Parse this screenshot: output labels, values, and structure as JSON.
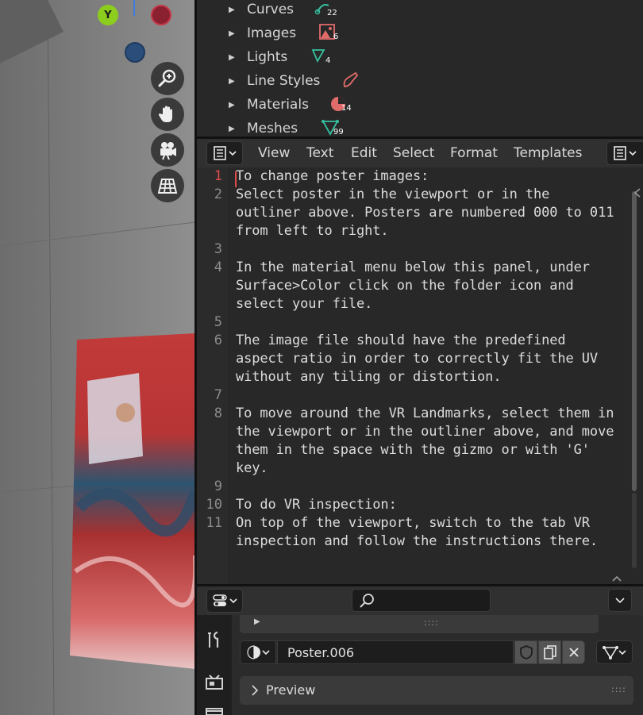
{
  "viewport": {
    "gizmo_y_label": "Y",
    "nav_buttons": [
      "zoom-icon",
      "hand-pan-icon",
      "camera-icon",
      "grid-perspective-icon"
    ]
  },
  "outliner": {
    "items": [
      {
        "label": "Curves",
        "count": "22",
        "icon": "curve-icon"
      },
      {
        "label": "Images",
        "count": "6",
        "icon": "image-icon"
      },
      {
        "label": "Lights",
        "count": "4",
        "icon": "light-icon"
      },
      {
        "label": "Line Styles",
        "count": "",
        "icon": "brush-icon"
      },
      {
        "label": "Materials",
        "count": "14",
        "icon": "material-icon"
      },
      {
        "label": "Meshes",
        "count": "99",
        "icon": "mesh-icon"
      }
    ]
  },
  "text_editor": {
    "menu": [
      "View",
      "Text",
      "Edit",
      "Select",
      "Format",
      "Templates"
    ],
    "line_numbers": [
      "1",
      "2",
      "",
      "",
      "3",
      "4",
      "",
      "",
      "5",
      "6",
      "",
      "",
      "7",
      "8",
      "",
      "",
      "",
      "9",
      "10",
      "11"
    ],
    "lines": [
      "To change poster images:",
      "Select poster in the viewport or in the",
      "outliner above. Posters are numbered 000 to 011",
      "from left to right.",
      "",
      "In the material menu below this panel, under",
      "Surface>Color click on the folder icon and",
      "select your file.",
      "",
      "The image file should have the predefined",
      "aspect ratio in order to correctly fit the UV",
      "without any tiling or distortion.",
      "",
      "To move around the VR Landmarks, select them in",
      "the viewport or in the outliner above, and move",
      "them in the space with the gizmo or with 'G'",
      "key.",
      "",
      "To do VR inspection:",
      "On top of the viewport, switch to the tab VR",
      "inspection and follow the instructions there."
    ]
  },
  "properties": {
    "search_placeholder": "",
    "material_name": "Poster.006",
    "preview_label": "Preview",
    "handle_glyph": "::::"
  },
  "colors": {
    "accent_red": "#e04a4a",
    "gizmo_y": "#8ccd1e",
    "gizmo_x_neg": "#8a2030",
    "gizmo_z_neg": "#2a4d7a"
  }
}
